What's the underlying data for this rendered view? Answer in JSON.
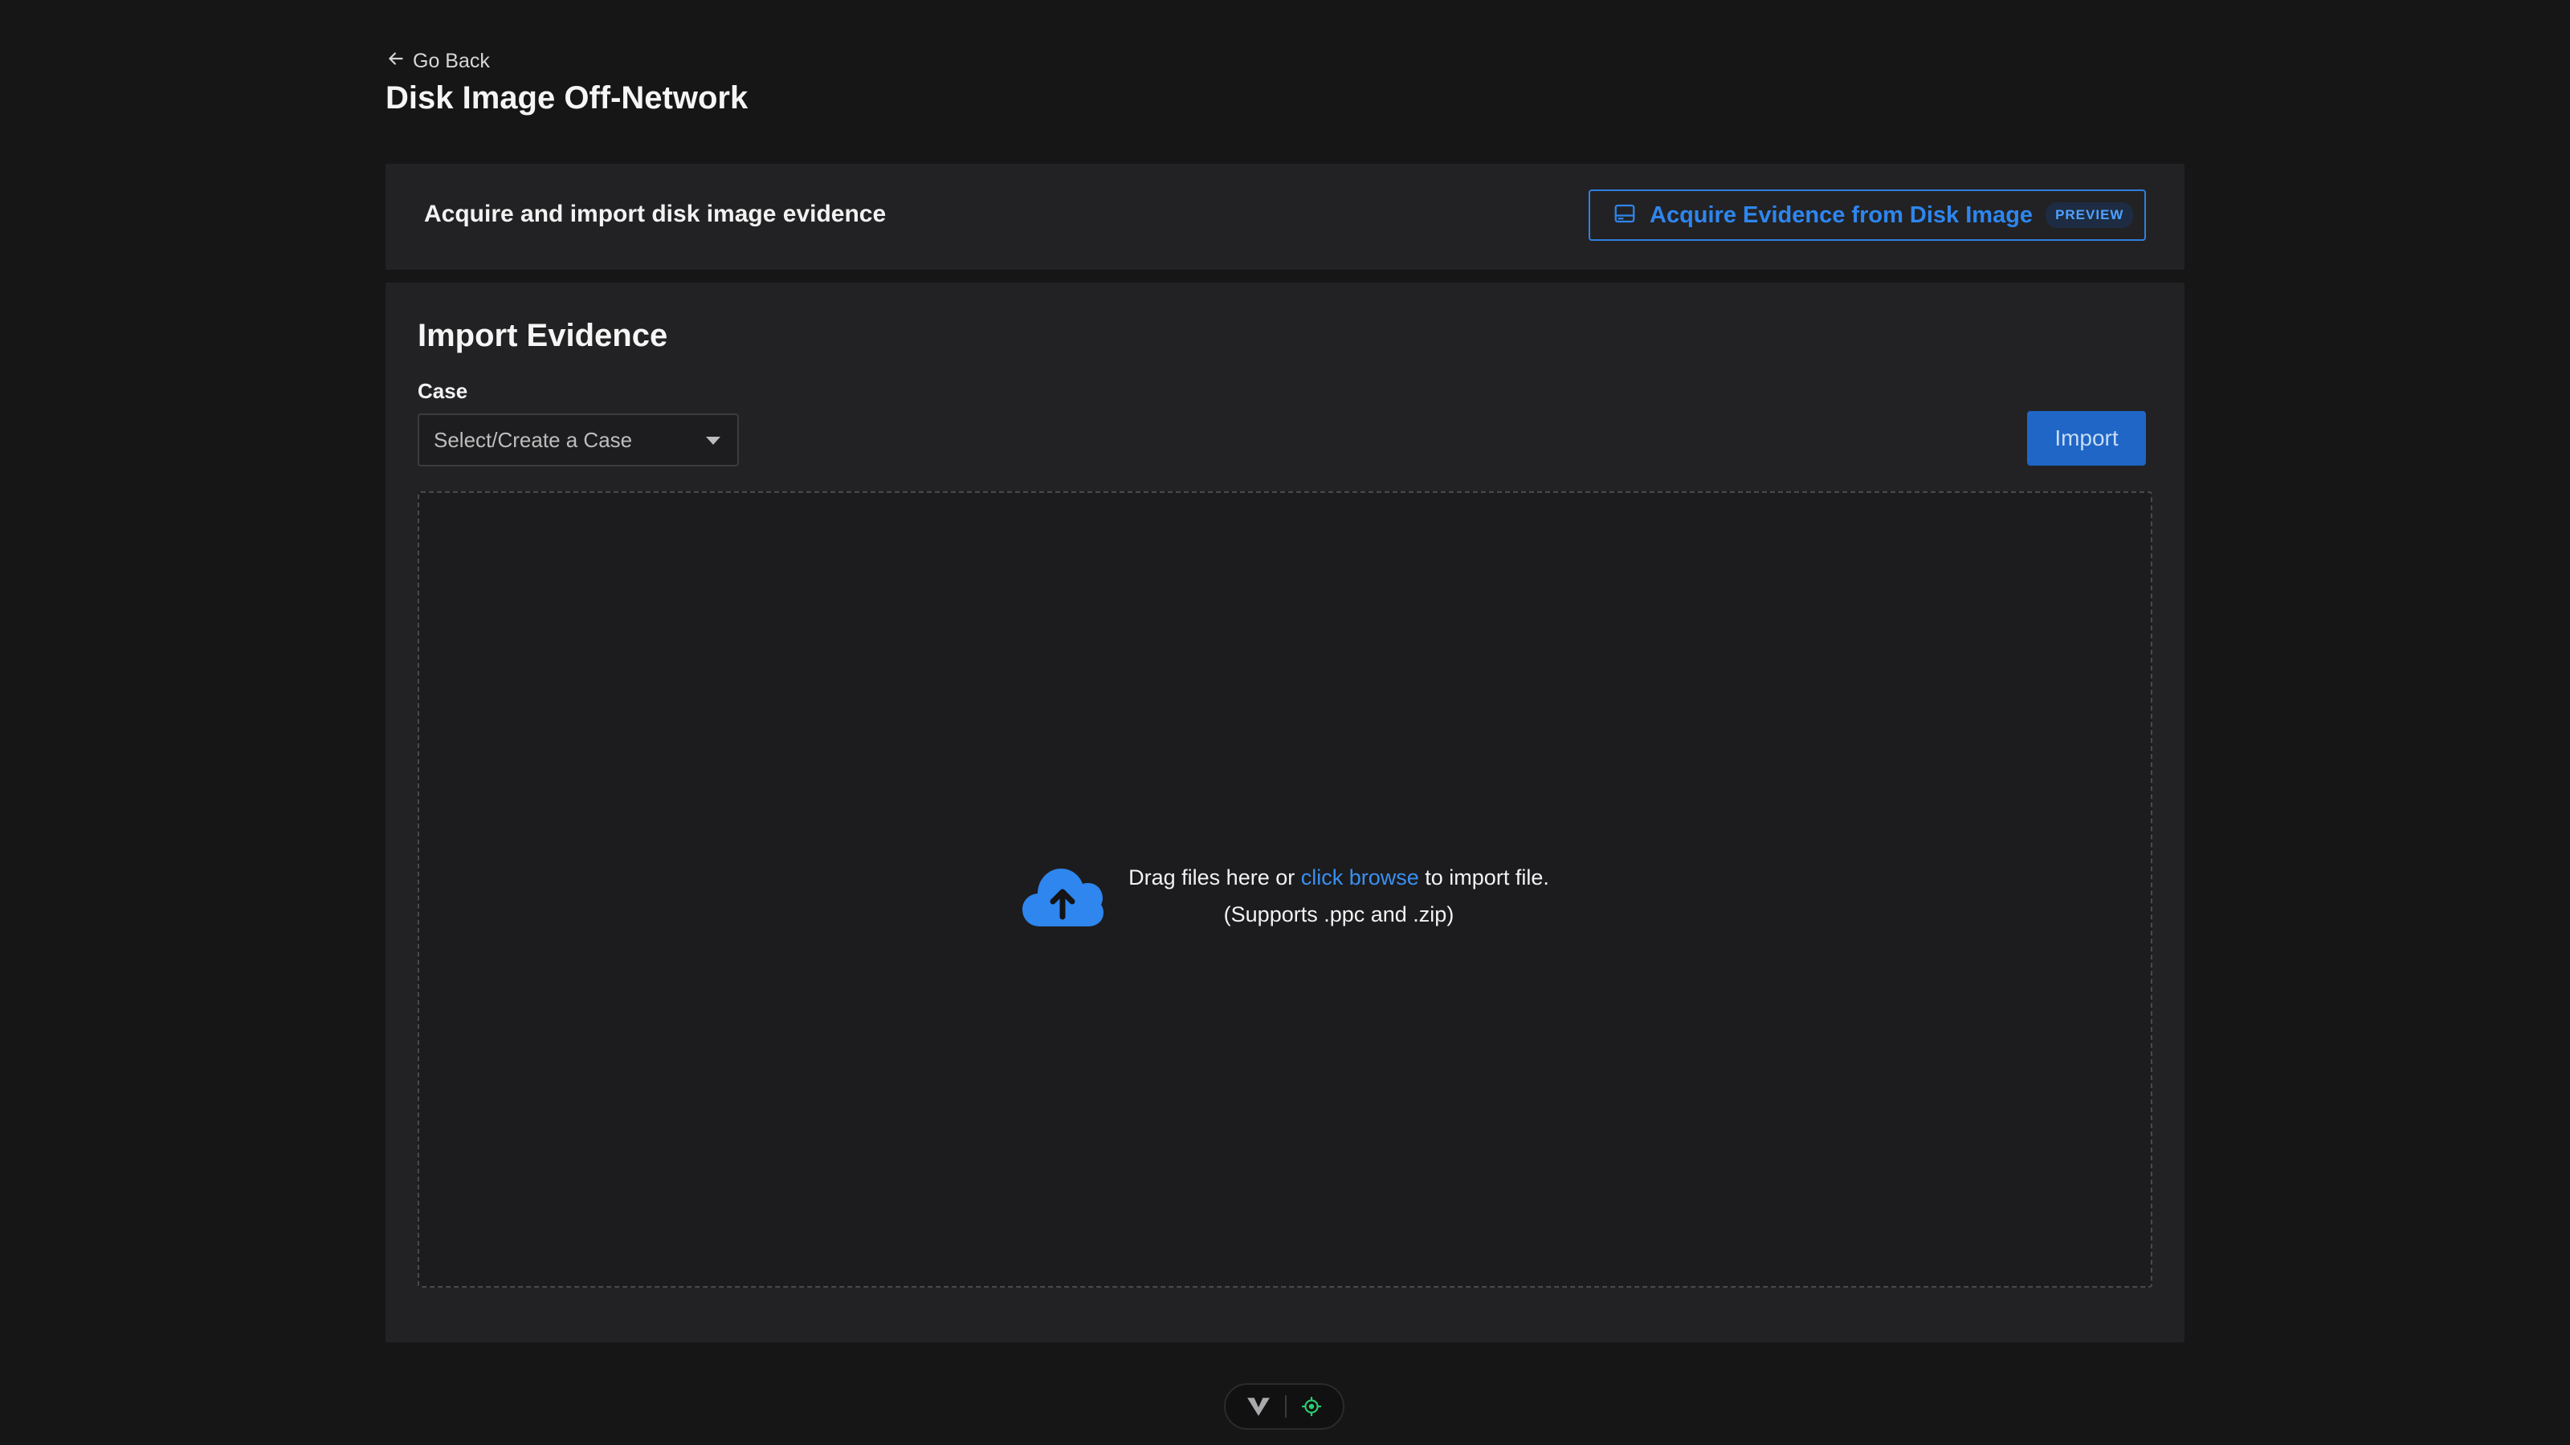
{
  "nav": {
    "back_label": "Go Back"
  },
  "page": {
    "title": "Disk Image Off-Network"
  },
  "banner": {
    "text": "Acquire and import disk image evidence",
    "acquire_button_label": "Acquire Evidence from Disk Image",
    "preview_badge": "PREVIEW"
  },
  "import_panel": {
    "title": "Import Evidence",
    "case_label": "Case",
    "case_placeholder": "Select/Create a Case",
    "import_button_label": "Import",
    "dropzone": {
      "text_before": "Drag files here or ",
      "link_text": "click browse",
      "text_after": " to import file.",
      "supports_text": "(Supports .ppc and .zip)"
    }
  },
  "colors": {
    "accent": "#2e86ee",
    "background": "#161617",
    "panel": "#222224",
    "status_green": "#2ecc71"
  },
  "icons": {
    "back": "arrow-left-icon",
    "disk": "hard-drive-icon",
    "dropdown": "caret-down-icon",
    "upload": "cloud-upload-icon",
    "footer_logo": "v-logo-icon",
    "footer_status": "target-icon"
  }
}
